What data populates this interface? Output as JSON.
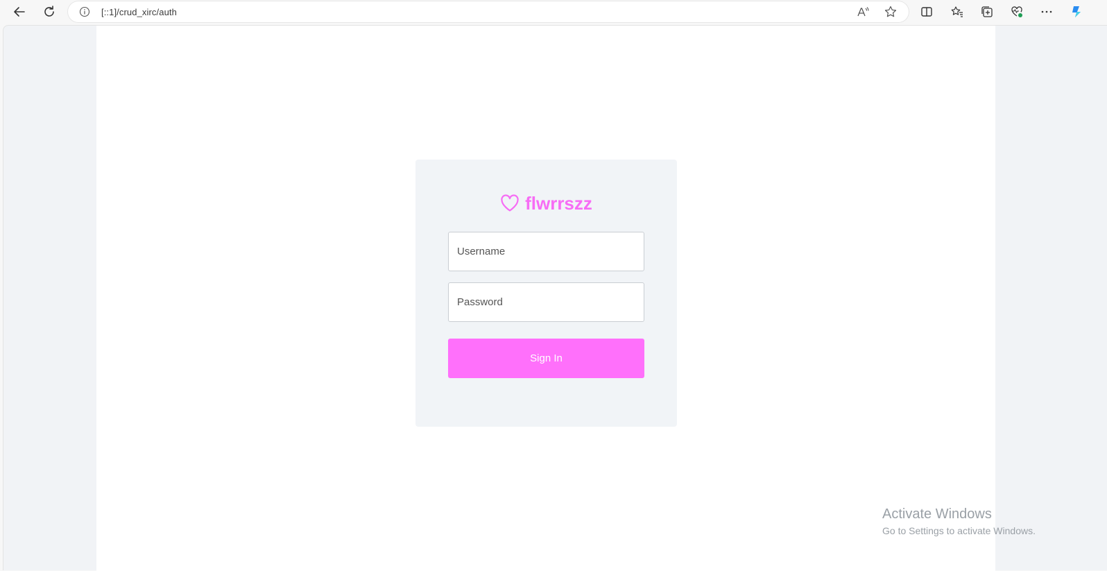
{
  "browser": {
    "url": "[::1]/crud_xirc/auth",
    "icons": [
      "back-arrow-icon",
      "refresh-icon",
      "info-icon",
      "read-aloud-icon",
      "favorite-star-icon",
      "split-screen-icon",
      "favorites-icon",
      "collections-icon",
      "browser-health-icon",
      "more-menu-icon",
      "copilot-icon"
    ]
  },
  "login": {
    "brand_name": "flwrrszz",
    "brand_icon": "heart-icon",
    "username_placeholder": "Username",
    "password_placeholder": "Password",
    "signin_label": "Sign In"
  },
  "watermark": {
    "title": "Activate Windows",
    "subtitle": "Go to Settings to activate Windows."
  },
  "colors": {
    "accent": "#ff70fb",
    "brand_text": "#f76cf5",
    "card_bg": "#f1f4f7",
    "page_bg": "#ffffff",
    "outer_bg": "#f1f3f6"
  }
}
